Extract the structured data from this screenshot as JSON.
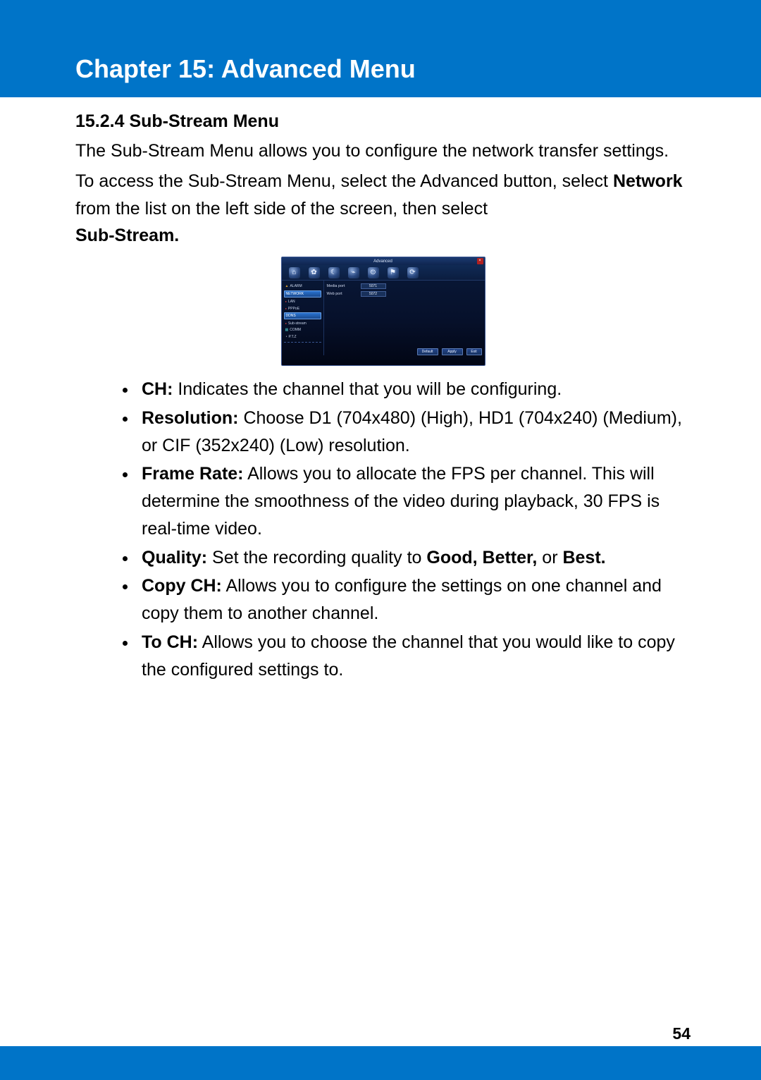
{
  "chapter": {
    "title": "Chapter 15: Advanced Menu"
  },
  "section": {
    "heading": "15.2.4 Sub-Stream Menu"
  },
  "para1": "The Sub-Stream Menu allows you to configure the network transfer settings.",
  "para2a": "To access the Sub-Stream Menu, select the Advanced button, select ",
  "para2b_bold": "Network",
  "para2c": " from the list on the left side of the screen, then select ",
  "para2d_bold": "Sub-Stream.",
  "dvr": {
    "title": "Advanced",
    "close": "×",
    "icons": [
      "⌂",
      "✿",
      "☾",
      "⌁",
      "⊙",
      "⚑",
      "⟳"
    ],
    "side": {
      "alarm": "ALARM",
      "network_hl": "NETWORK",
      "lan": "LAN",
      "pppoe": "PPPoE",
      "ddns_hl": "DDNS",
      "substream": "Sub-stream",
      "comm": "COMM",
      "ptz": "P.T.Z"
    },
    "fields": {
      "media_label": "Media port",
      "media_val": "5071",
      "web_label": "Web port",
      "web_val": "5072"
    },
    "buttons": {
      "default": "Default",
      "apply": "Apply",
      "exit": "Exit"
    }
  },
  "bullets": [
    {
      "term": "CH:",
      "text": " Indicates the channel that you will be configuring."
    },
    {
      "term": "Resolution:",
      "text": " Choose D1 (704x480) (High), HD1 (704x240) (Medium), or CIF (352x240) (Low) resolution."
    },
    {
      "term": "Frame Rate:",
      "text": " Allows you to allocate the FPS per channel. This will determine the smoothness of the video during playback, 30 FPS is real-time video."
    },
    {
      "term": "Quality:",
      "text": " Set the recording quality to ",
      "bold2": "Good, Better,",
      "text2": " or ",
      "bold3": "Best."
    },
    {
      "term": "Copy CH:",
      "text": " Allows you to configure the settings on one channel and copy them to another channel."
    },
    {
      "term": "To CH:",
      "text": " Allows you to choose the channel that you would like to copy the configured settings to."
    }
  ],
  "page_number": "54"
}
